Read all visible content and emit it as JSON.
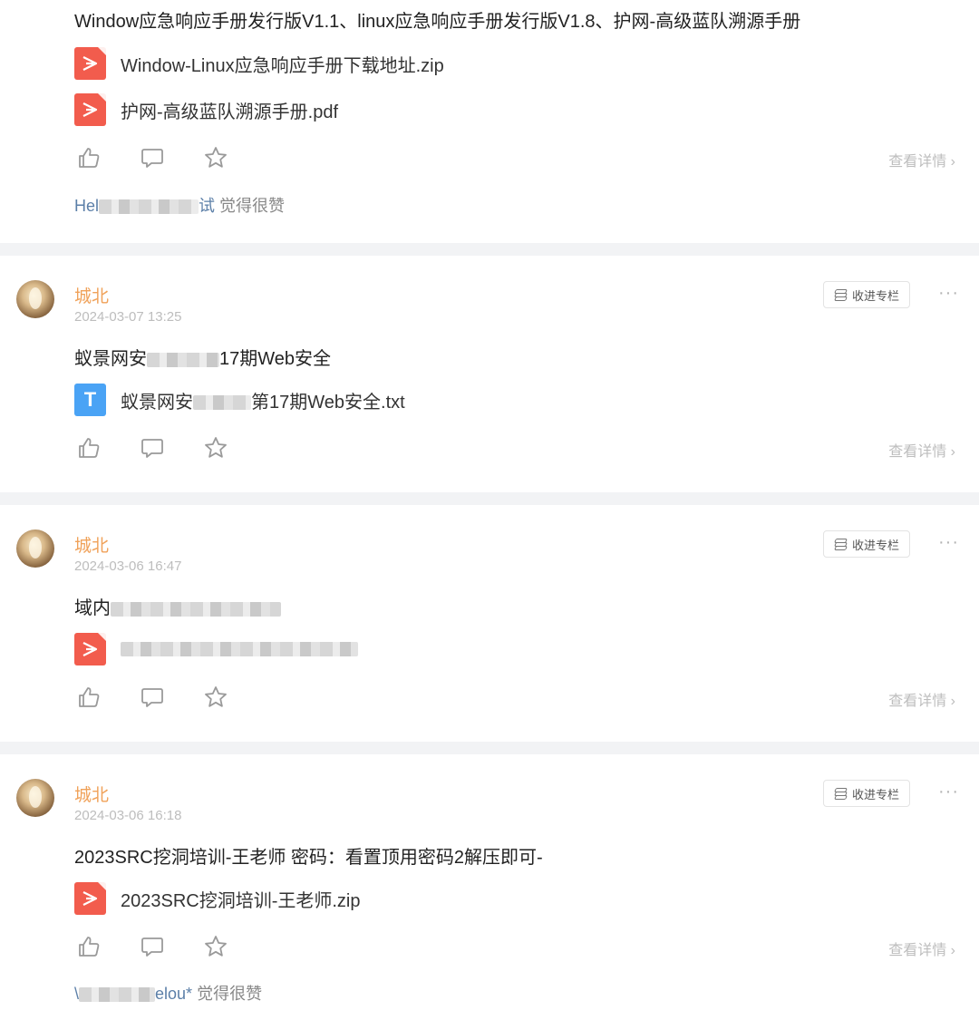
{
  "posts": [
    {
      "title": "Window应急响应手册发行版V1.1、linux应急响应手册发行版V1.8、护网-高级蓝队溯源手册",
      "files": [
        {
          "type": "pdf",
          "name": "Window-Linux应急响应手册下载地址.zip"
        },
        {
          "type": "pdf",
          "name": "护网-高级蓝队溯源手册.pdf"
        }
      ],
      "detail": "查看详情 ›",
      "liker": {
        "name_start": "Hel",
        "name_end": "试",
        "suffix": " 觉得很赞"
      }
    },
    {
      "author": "城北",
      "time": "2024-03-07 13:25",
      "collect": "收进专栏",
      "more": "···",
      "title_start": "蚁景网安",
      "title_end": "17期Web安全",
      "files": [
        {
          "type": "txt",
          "icon_letter": "T",
          "name_start": "蚁景网安",
          "name_end": "第17期Web安全.txt"
        }
      ],
      "detail": "查看详情 ›"
    },
    {
      "author": "城北",
      "time": "2024-03-06 16:47",
      "collect": "收进专栏",
      "more": "···",
      "title_start": "域内",
      "files": [
        {
          "type": "pdf",
          "name": ""
        }
      ],
      "detail": "查看详情 ›"
    },
    {
      "author": "城北",
      "time": "2024-03-06 16:18",
      "collect": "收进专栏",
      "more": "···",
      "title": "2023SRC挖洞培训-王老师 密码：看置顶用密码2解压即可-",
      "files": [
        {
          "type": "pdf",
          "name": "2023SRC挖洞培训-王老师.zip"
        }
      ],
      "detail": "查看详情 ›",
      "liker": {
        "name_start": "\\",
        "name_end": "elou*",
        "suffix": " 觉得很赞"
      }
    }
  ],
  "icons": {
    "like": "thumbs-up-icon",
    "comment": "comment-icon",
    "favorite": "star-icon",
    "pdf": "pdf-file-icon",
    "txt": "txt-file-icon"
  },
  "colors": {
    "author": "#f0a25a",
    "pdf": "#f25c4d",
    "txt": "#4aa3f5",
    "liker": "#5b7fa8",
    "separator": "#f2f3f5"
  }
}
